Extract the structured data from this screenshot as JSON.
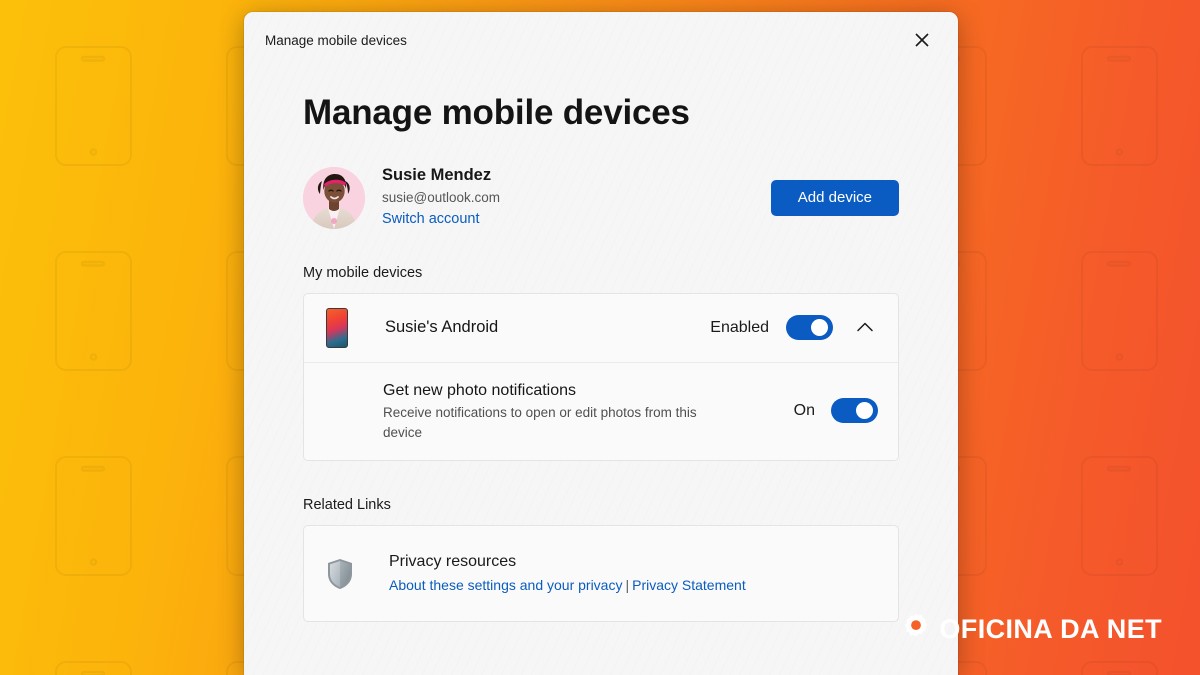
{
  "window": {
    "titlebar_title": "Manage mobile devices",
    "close_icon": "close-icon"
  },
  "page": {
    "title": "Manage mobile devices"
  },
  "account": {
    "avatar_alt": "Susie Mendez profile photo",
    "name": "Susie Mendez",
    "email": "susie@outlook.com",
    "switch_account_label": "Switch account",
    "add_device_label": "Add device"
  },
  "devices_section": {
    "heading": "My mobile devices",
    "device": {
      "thumbnail_icon": "phone-thumbnail-icon",
      "name": "Susie's Android",
      "state_label": "Enabled",
      "toggle_state": "on",
      "expand_icon": "chevron-up-icon",
      "expanded": true
    },
    "setting": {
      "title": "Get new photo notifications",
      "description": "Receive notifications to open or edit photos from this device",
      "state_label": "On",
      "toggle_state": "on"
    }
  },
  "related_links_section": {
    "heading": "Related Links",
    "privacy": {
      "icon": "shield-icon",
      "title": "Privacy resources",
      "link_primary": "About these settings and your privacy",
      "separator": "|",
      "link_secondary": "Privacy Statement"
    }
  },
  "watermark": {
    "icon": "gear-icon",
    "text": "OFICINA DA NET"
  },
  "colors": {
    "accent_blue": "#0a5cc2",
    "link_blue": "#0b5cbf",
    "bg_gradient_start": "#fcc00a",
    "bg_gradient_end": "#f4512d",
    "dialog_bg": "#f6f6f6",
    "card_bg": "#fafafa"
  }
}
